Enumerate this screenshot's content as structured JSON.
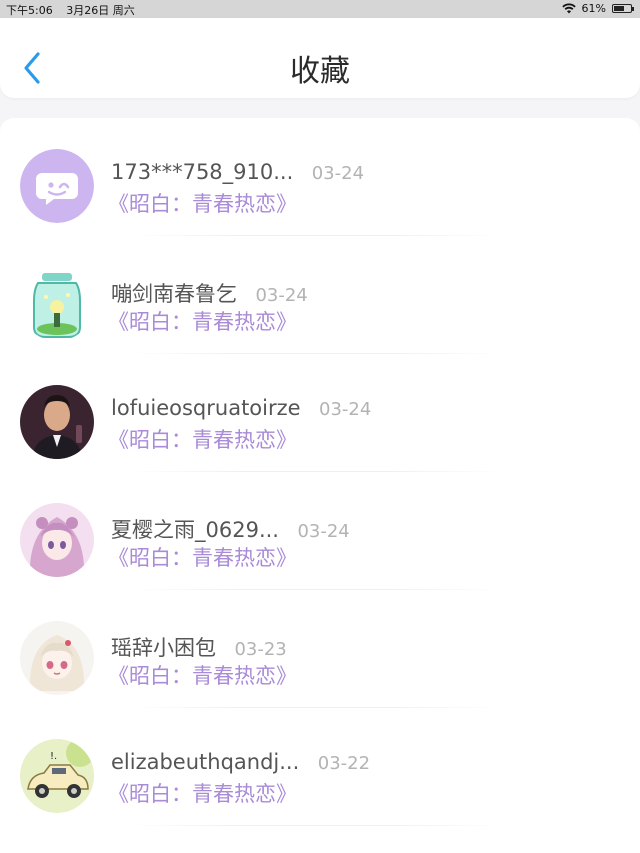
{
  "status_bar": {
    "time": "下午5:06",
    "date": "3月26日 周六",
    "battery_text": "61%",
    "battery_level": 0.61
  },
  "header": {
    "title": "收藏",
    "back_icon": "chevron-left-icon",
    "accent_color": "#2a9be8"
  },
  "items": [
    {
      "username": "173***758_910...",
      "date": "03-24",
      "book": "《昭白：青春热恋》",
      "avatar": "chat-bubble-icon"
    },
    {
      "username": "嘣剑南春鲁乞",
      "date": "03-24",
      "book": "《昭白：青春热恋》",
      "avatar": "glass-jar-avatar"
    },
    {
      "username": "lofuieosqruatoirze",
      "date": "03-24",
      "book": "《昭白：青春热恋》",
      "avatar": "man-photo-avatar"
    },
    {
      "username": "夏樱之雨_0629...",
      "date": "03-24",
      "book": "《昭白：青春热恋》",
      "avatar": "anime-girl-avatar"
    },
    {
      "username": "瑶辞小困包",
      "date": "03-23",
      "book": "《昭白：青春热恋》",
      "avatar": "anime-white-hair-avatar"
    },
    {
      "username": "elizabeuthqandj...",
      "date": "03-22",
      "book": "《昭白：青春热恋》",
      "avatar": "toy-car-avatar"
    }
  ],
  "colors": {
    "book_title": "#a98bd8",
    "username": "#555555",
    "date": "#b3b3b3",
    "page_bg": "#f5f4f6"
  }
}
